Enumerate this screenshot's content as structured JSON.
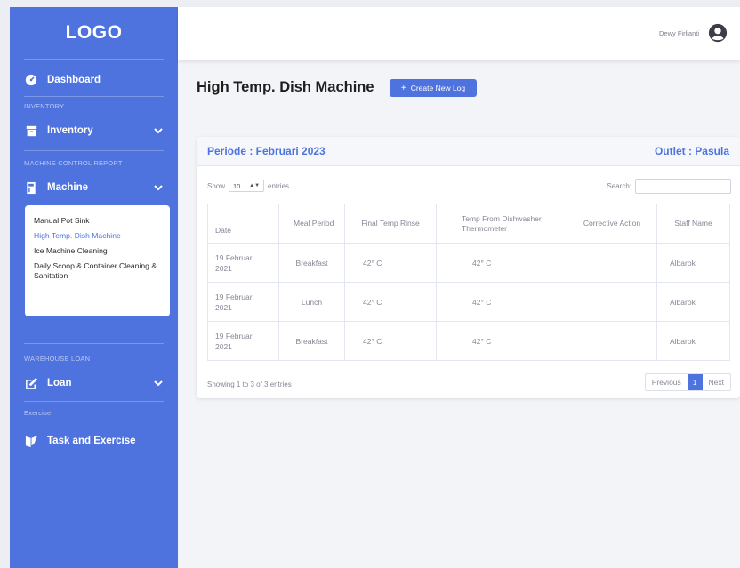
{
  "logo": "LOGO",
  "sidebar": {
    "dashboard": "Dashboard",
    "section_inventory": "INVENTORY",
    "inventory": "Inventory",
    "section_machine": "MACHINE CONTROL REPORT",
    "machine": "Machine",
    "submenu": [
      "Manual Pot Sink",
      "High Temp. Dish Machine",
      "Ice Machine Cleaning",
      "Daily Scoop & Container Cleaning & Sanitation"
    ],
    "section_warehouse": "WAREHOUSE LOAN",
    "loan": "Loan",
    "section_exercise": "Exercise",
    "task": "Task and Exercise"
  },
  "topbar": {
    "username": "Dewy Firlianti"
  },
  "page": {
    "title": "High Temp. Dish Machine",
    "create_button": "Create New Log"
  },
  "card": {
    "periode": "Periode : Februari 2023",
    "outlet": "Outlet : Pasula",
    "show_label": "Show",
    "entries_value": "10",
    "entries_label": "entries",
    "search_label": "Search:",
    "columns": [
      "Date",
      "Meal Period",
      "Final Temp Rinse",
      "Temp From Dishwasher Thermometer",
      "Corrective Action",
      "Staff Name"
    ],
    "rows": [
      {
        "date": "19 Februari 2021",
        "meal": "Breakfast",
        "rinse": "42° C",
        "thermo": "42° C",
        "action": "",
        "staff": "Albarok"
      },
      {
        "date": "19 Februari 2021",
        "meal": "Lunch",
        "rinse": "42° C",
        "thermo": "42° C",
        "action": "",
        "staff": "Albarok"
      },
      {
        "date": "19 Februari 2021",
        "meal": "Breakfast",
        "rinse": "42° C",
        "thermo": "42° C",
        "action": "",
        "staff": "Albarok"
      }
    ],
    "info": "Showing 1 to 3 of 3 entries",
    "pagination": {
      "previous": "Previous",
      "current": "1",
      "next": "Next"
    }
  },
  "colors": {
    "primary": "#4e73df",
    "background": "#f3f4f7"
  }
}
